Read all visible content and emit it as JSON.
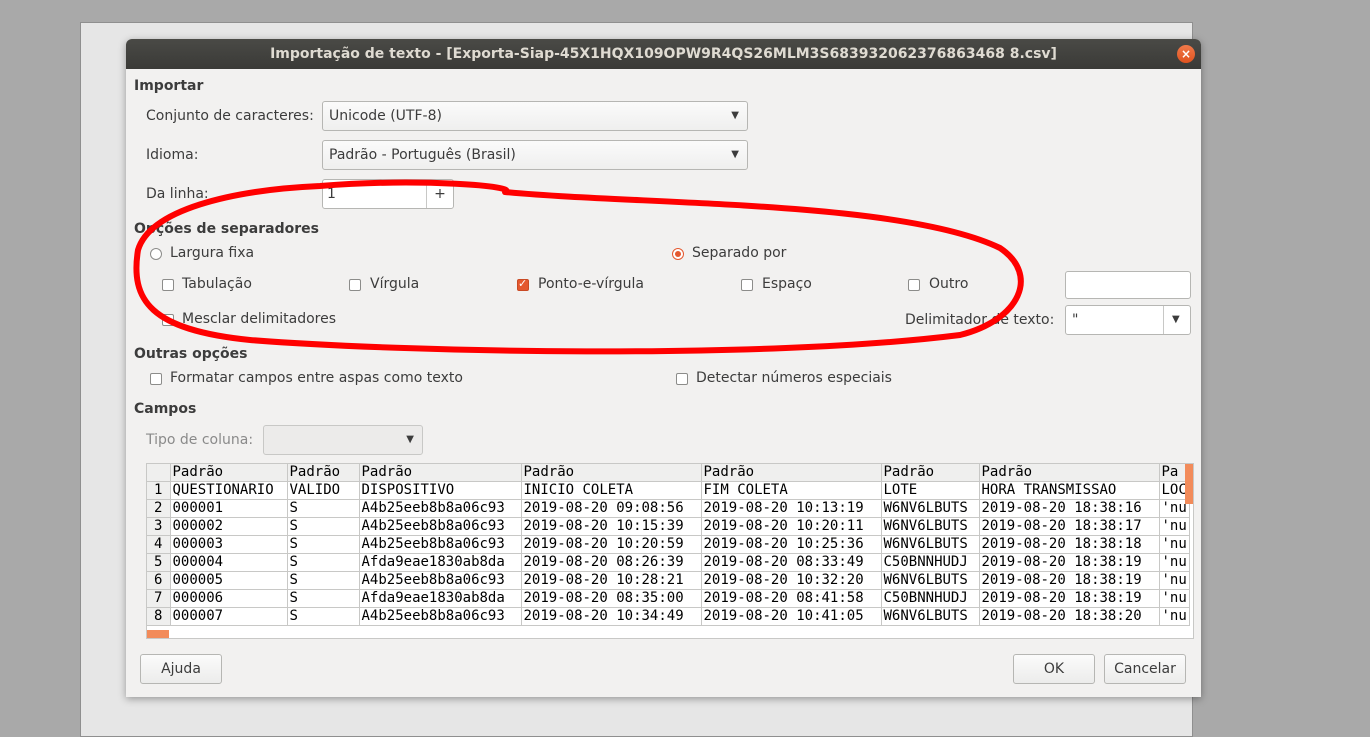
{
  "dialog": {
    "title": "Importação de texto - [Exporta-Siap-45X1HQX109OPW9R4QS26MLM3S683932062376863468 8.csv]",
    "close_glyph": "×"
  },
  "importar": {
    "section": "Importar",
    "charset_label": "Conjunto de caracteres:",
    "charset_value": "Unicode (UTF-8)",
    "idioma_label": "Idioma:",
    "idioma_value": "Padrão - Português (Brasil)",
    "from_line_label": "Da linha:",
    "from_line_value": "1",
    "from_line_plus": "+"
  },
  "separadores": {
    "section": "Opções de separadores",
    "fixed_width": "Largura fixa",
    "separated_by": "Separado por",
    "tab": "Tabulação",
    "comma": "Vírgula",
    "semicolon": "Ponto-e-vírgula",
    "space": "Espaço",
    "other": "Outro",
    "merge": "Mesclar delimitadores",
    "text_delim_label": "Delimitador de texto:",
    "text_delim_value": "\""
  },
  "outras": {
    "section": "Outras opções",
    "quoted_as_text": "Formatar campos entre aspas como texto",
    "special_numbers": "Detectar números especiais"
  },
  "campos": {
    "section": "Campos",
    "col_type_label": "Tipo de coluna:",
    "col_type_value": ""
  },
  "table": {
    "headers": [
      "Padrão",
      "Padrão",
      "Padrão",
      "Padrão",
      "Padrão",
      "Padrão",
      "Padrão",
      "Pa"
    ],
    "rows": [
      [
        "1",
        "QUESTIONARIO",
        "VALIDO",
        "DISPOSITIVO",
        "INICIO COLETA",
        "FIM COLETA",
        "LOTE",
        "HORA TRANSMISSAO",
        "LOC"
      ],
      [
        "2",
        "000001",
        "S",
        "A4b25eeb8b8a06c93",
        "2019-08-20 09:08:56",
        "2019-08-20 10:13:19",
        "W6NV6LBUTS",
        "2019-08-20 18:38:16",
        "'nu"
      ],
      [
        "3",
        "000002",
        "S",
        "A4b25eeb8b8a06c93",
        "2019-08-20 10:15:39",
        "2019-08-20 10:20:11",
        "W6NV6LBUTS",
        "2019-08-20 18:38:17",
        "'nu"
      ],
      [
        "4",
        "000003",
        "S",
        "A4b25eeb8b8a06c93",
        "2019-08-20 10:20:59",
        "2019-08-20 10:25:36",
        "W6NV6LBUTS",
        "2019-08-20 18:38:18",
        "'nu"
      ],
      [
        "5",
        "000004",
        "S",
        "Afda9eae1830ab8da",
        "2019-08-20 08:26:39",
        "2019-08-20 08:33:49",
        "C50BNNHUDJ",
        "2019-08-20 18:38:19",
        "'nu"
      ],
      [
        "6",
        "000005",
        "S",
        "A4b25eeb8b8a06c93",
        "2019-08-20 10:28:21",
        "2019-08-20 10:32:20",
        "W6NV6LBUTS",
        "2019-08-20 18:38:19",
        "'nu"
      ],
      [
        "7",
        "000006",
        "S",
        "Afda9eae1830ab8da",
        "2019-08-20 08:35:00",
        "2019-08-20 08:41:58",
        "C50BNNHUDJ",
        "2019-08-20 18:38:19",
        "'nu"
      ],
      [
        "8",
        "000007",
        "S",
        "A4b25eeb8b8a06c93",
        "2019-08-20 10:34:49",
        "2019-08-20 10:41:05",
        "W6NV6LBUTS",
        "2019-08-20 18:38:20",
        "'nu"
      ]
    ]
  },
  "buttons": {
    "help": "Ajuda",
    "ok": "OK",
    "cancel": "Cancelar"
  },
  "colors": {
    "accent": "#e4582f",
    "annotation": "#ff0000"
  }
}
